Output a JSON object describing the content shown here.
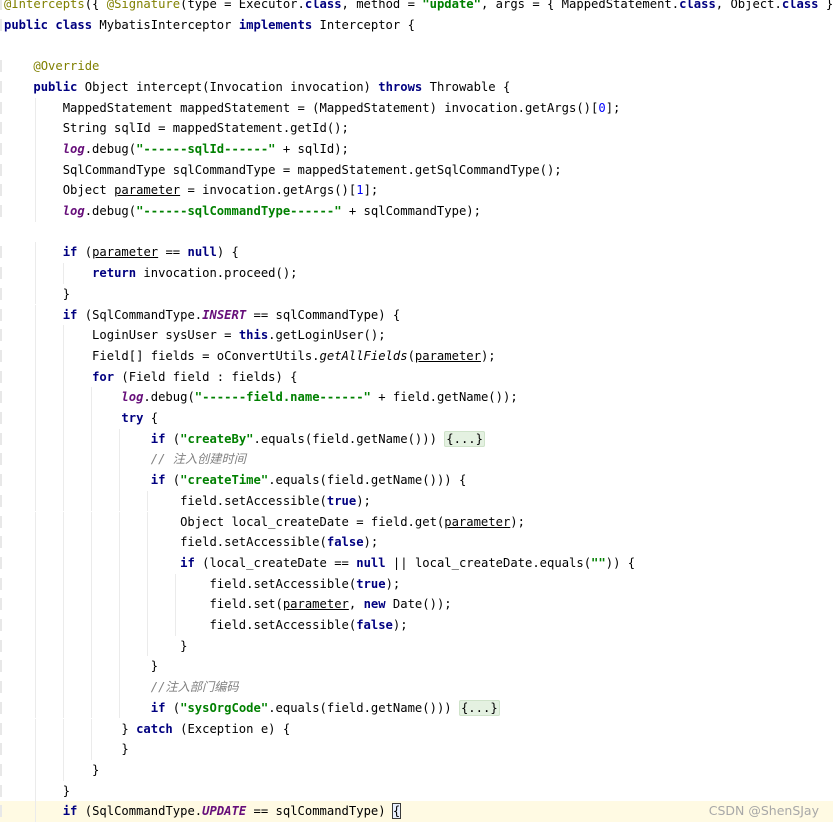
{
  "editor": {
    "lines": [
      "@Intercepts({ @Signature(type = Executor.class, method = \"update\", args = { MappedStatement.class, Object.class }) })",
      "public class MybatisInterceptor implements Interceptor {",
      "",
      "    @Override",
      "    public Object intercept(Invocation invocation) throws Throwable {",
      "        MappedStatement mappedStatement = (MappedStatement) invocation.getArgs()[0];",
      "        String sqlId = mappedStatement.getId();",
      "        log.debug(\"------sqlId------\" + sqlId);",
      "        SqlCommandType sqlCommandType = mappedStatement.getSqlCommandType();",
      "        Object parameter = invocation.getArgs()[1];",
      "        log.debug(\"------sqlCommandType------\" + sqlCommandType);",
      "",
      "        if (parameter == null) {",
      "            return invocation.proceed();",
      "        }",
      "        if (SqlCommandType.INSERT == sqlCommandType) {",
      "            LoginUser sysUser = this.getLoginUser();",
      "            Field[] fields = oConvertUtils.getAllFields(parameter);",
      "            for (Field field : fields) {",
      "                log.debug(\"------field.name------\" + field.getName());",
      "                try {",
      "                    if (\"createBy\".equals(field.getName())) {...}",
      "                    // 注入创建时间",
      "                    if (\"createTime\".equals(field.getName())) {",
      "                        field.setAccessible(true);",
      "                        Object local_createDate = field.get(parameter);",
      "                        field.setAccessible(false);",
      "                        if (local_createDate == null || local_createDate.equals(\"\")) {",
      "                            field.setAccessible(true);",
      "                            field.set(parameter, new Date());",
      "                            field.setAccessible(false);",
      "                        }",
      "                    }",
      "                    //注入部门编码",
      "                    if (\"sysOrgCode\".equals(field.getName())) {...}",
      "                } catch (Exception e) {",
      "                }",
      "            }",
      "        }",
      "        if (SqlCommandType.UPDATE == sqlCommandType) {"
    ]
  },
  "watermark": "CSDN @ShenSJay",
  "colors": {
    "keyword": "#000080",
    "annotation": "#808000",
    "string": "#008000",
    "number": "#0000ff",
    "comment": "#808080",
    "static_field": "#660e7a",
    "current_line": "#fffae3"
  }
}
